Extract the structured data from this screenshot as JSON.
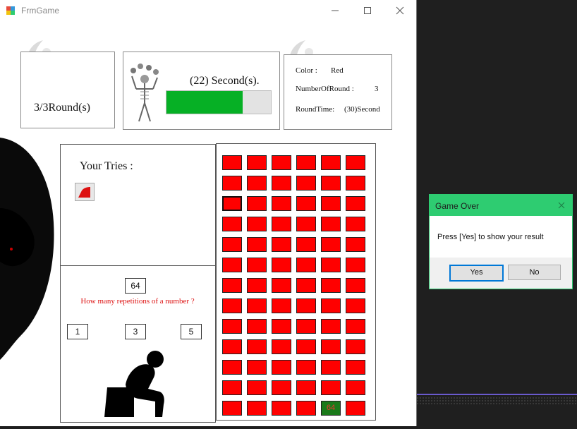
{
  "window": {
    "title": "FrmGame"
  },
  "round_panel": {
    "text": "3/3Round(s)"
  },
  "timer_panel": {
    "seconds_text": "(22) Second(s).",
    "progress_fraction": 0.73,
    "bar_color": "#06b025"
  },
  "info_panel": {
    "color_label": "Color :",
    "color_value": "Red",
    "rounds_label": "NumberOfRound :",
    "rounds_value": "3",
    "time_label": "RoundTime:",
    "time_value": "(30)Second"
  },
  "tries_panel": {
    "label": "Your Tries :"
  },
  "question_panel": {
    "number": "64",
    "question": "How many repetitions of a number ?",
    "answers": [
      "1",
      "3",
      "5"
    ]
  },
  "grid": {
    "rows": 13,
    "cols": 6,
    "selected": [
      2,
      0
    ],
    "found_cell": [
      12,
      4
    ],
    "found_text": "64",
    "cell_color": "#ff0000"
  },
  "dialog": {
    "title": "Game Over",
    "message": "Press [Yes] to show your result",
    "yes": "Yes",
    "no": "No",
    "accent": "#2ecc71"
  }
}
